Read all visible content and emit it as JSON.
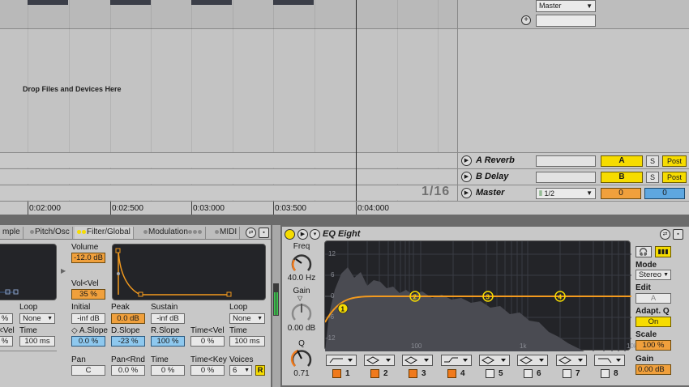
{
  "arrangement": {
    "drop_text": "Drop Files and Devices Here",
    "quantization": "1/16"
  },
  "mixer": {
    "master_dropdown": "Master",
    "add_icon": "plus-circle-icon",
    "returns": [
      {
        "name": "A Reverb",
        "send_label": "A",
        "solo": "S",
        "post": "Post"
      },
      {
        "name": "B Delay",
        "send_label": "B",
        "solo": "S",
        "post": "Post"
      }
    ],
    "master": {
      "name": "Master",
      "cue_select": "1/2",
      "cue_volume": "0",
      "pan_value": "0"
    }
  },
  "ruler": {
    "ticks": [
      "0:02:000",
      "0:02:500",
      "0:03:000",
      "0:03:500",
      "0:04:000"
    ]
  },
  "sampler": {
    "tabs": [
      "mple",
      "Pitch/Osc",
      "Filter/Global",
      "Modulation",
      "MIDI"
    ],
    "volume_label": "Volume",
    "volume_value": "-12.0 dB",
    "vol_vel_label": "Vol<Vel",
    "vol_vel_value": "35 %",
    "initial_label": "Initial",
    "initial_value": "-inf dB",
    "peak_label": "Peak",
    "peak_value": "0.0 dB",
    "sustain_label": "Sustain",
    "sustain_value": "-inf dB",
    "loop_label": "Loop",
    "loop_value": "None",
    "left_loop_label": "Loop",
    "left_loop_value": "None",
    "left_pct_value": "%",
    "left_vel_label": "<Vel",
    "left_vel_value": "%",
    "left_time_label": "Time",
    "left_time_value": "100 ms",
    "aslope_label": "A.Slope",
    "aslope_value": "0.0 %",
    "dslope_label": "D.Slope",
    "dslope_value": "-23 %",
    "rslope_label": "R.Slope",
    "rslope_value": "100 %",
    "time_vel_label": "Time<Vel",
    "time_vel_value": "0 %",
    "time_label": "Time",
    "time_value": "100 ms",
    "pan_label": "Pan",
    "pan_value": "C",
    "pan_rnd_label": "Pan<Rnd",
    "pan_rnd_value": "0.0 %",
    "time2_label": "Time",
    "time2_value": "0 %",
    "time_key_label": "Time<Key",
    "time_key_value": "0 %",
    "voices_label": "Voices",
    "voices_value": "6",
    "retrigger": "R"
  },
  "eq": {
    "title": "EQ Eight",
    "freq_label": "Freq",
    "freq_value": "40.0 Hz",
    "gain_label": "Gain",
    "gain_value": "0.00 dB",
    "q_label": "Q",
    "q_value": "0.71",
    "db_labels": [
      "12",
      "6",
      "0",
      "-6",
      "-12"
    ],
    "freq_labels": [
      "100",
      "1k",
      "10k"
    ],
    "bands": [
      "1",
      "2",
      "3",
      "4",
      "5",
      "6",
      "7",
      "8"
    ],
    "bands_on": [
      true,
      true,
      true,
      true,
      false,
      false,
      false,
      false
    ],
    "mode_label": "Mode",
    "mode_value": "Stereo",
    "edit_label": "Edit",
    "edit_value": "A",
    "adaptq_label": "Adapt. Q",
    "adaptq_value": "On",
    "scale_label": "Scale",
    "scale_value": "100 %",
    "gain2_label": "Gain",
    "gain2_value": "0.00 dB"
  },
  "colors": {
    "accent_yellow": "#f6dc00",
    "accent_orange": "#f07a1c",
    "display_bg": "#232428",
    "eq_curve": "#f39a1e"
  }
}
